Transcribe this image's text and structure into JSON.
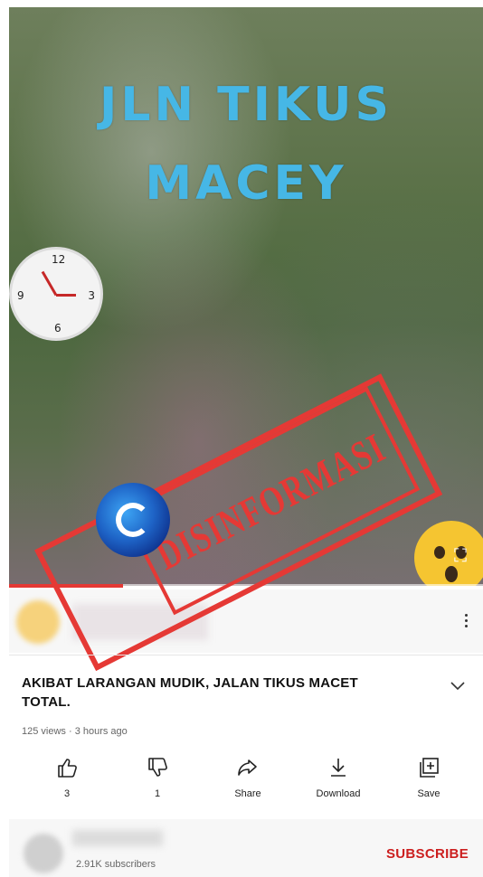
{
  "video": {
    "overlay_line1": "JLN TIKUS",
    "overlay_line2": "MACEY",
    "stamp_text": "DISINFORMASI",
    "clock_numbers": [
      "12",
      "3",
      "6",
      "9"
    ],
    "progress_fraction": 0.24
  },
  "details": {
    "title": "AKIBAT LARANGAN MUDIK, JALAN TIKUS MACET TOTAL.",
    "meta": "125 views · 3 hours ago"
  },
  "actions": [
    {
      "icon": "thumbs-up-icon",
      "label": "3"
    },
    {
      "icon": "thumbs-down-icon",
      "label": "1"
    },
    {
      "icon": "share-icon",
      "label": "Share"
    },
    {
      "icon": "download-icon",
      "label": "Download"
    },
    {
      "icon": "save-icon",
      "label": "Save"
    }
  ],
  "channel": {
    "subscribers": "2.91K subscribers",
    "subscribe_label": "SUBSCRIBE"
  },
  "colors": {
    "accent": "#cc1f1f",
    "overlay_text": "#46b7e6",
    "stamp": "#e53935"
  }
}
